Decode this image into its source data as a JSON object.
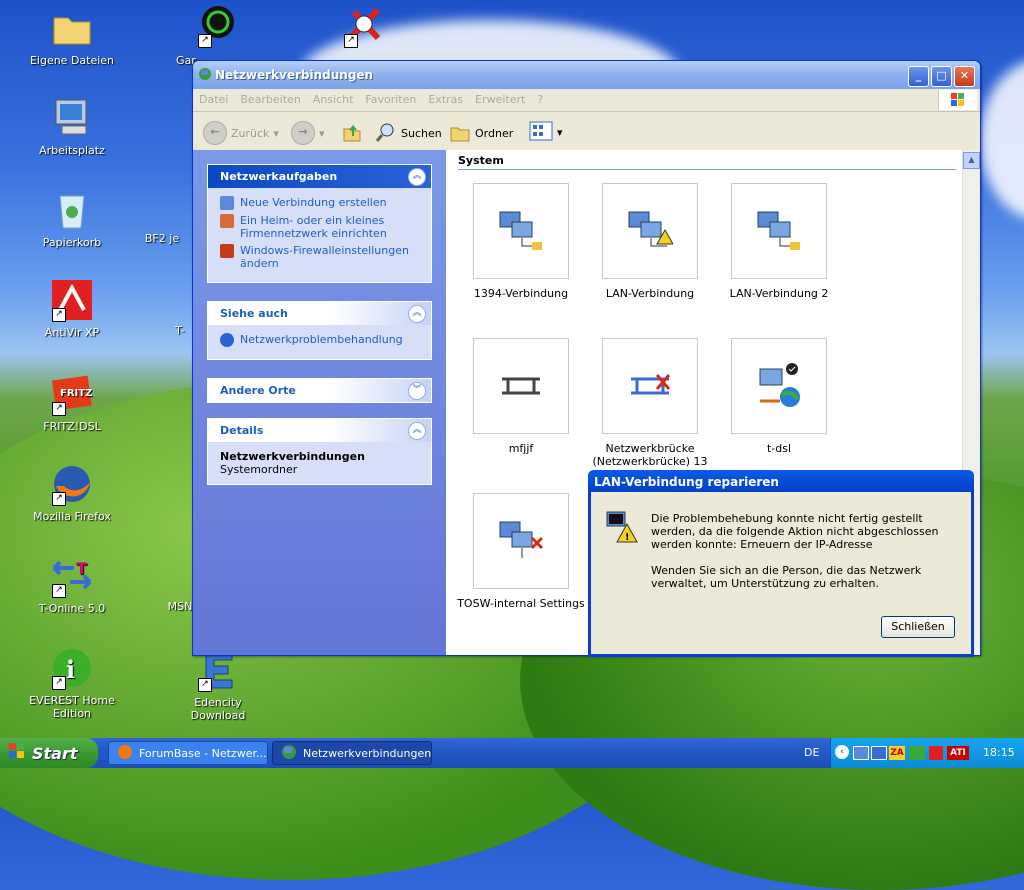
{
  "desktop": {
    "icons": [
      {
        "label": "Eigene Dateien"
      },
      {
        "label": "Arbeitsplatz"
      },
      {
        "label": "Papierkorb"
      },
      {
        "label": "AntiVir XP"
      },
      {
        "label": "FRITZ!DSL"
      },
      {
        "label": "Mozilla Firefox"
      },
      {
        "label": "T-Online 5.0"
      },
      {
        "label": "EVEREST Home Edition"
      },
      {
        "label": "Gar"
      },
      {
        "label": "BF2 je"
      },
      {
        "label": "T-"
      },
      {
        "label": "MSN"
      },
      {
        "label": "Edencity Download"
      }
    ]
  },
  "window": {
    "title": "Netzwerkverbindungen",
    "menu": [
      "Datei",
      "Bearbeiten",
      "Ansicht",
      "Favoriten",
      "Extras",
      "Erweitert",
      "?"
    ],
    "toolbar": {
      "back": "Zurück",
      "search": "Suchen",
      "folders": "Ordner"
    },
    "tasks": {
      "title": "Netzwerkaufgaben",
      "links": [
        "Neue Verbindung erstellen",
        "Ein Heim- oder ein kleines Firmennetzwerk einrichten",
        "Windows-Firewalleinstellungen ändern"
      ]
    },
    "see_also": {
      "title": "Siehe auch",
      "links": [
        "Netzwerkproblembehandlung"
      ]
    },
    "other_places": {
      "title": "Andere Orte"
    },
    "details": {
      "title": "Details",
      "name": "Netzwerkverbindungen",
      "type": "Systemordner"
    },
    "group_header": "System",
    "items": [
      {
        "label": "1394-Verbindung"
      },
      {
        "label": "LAN-Verbindung"
      },
      {
        "label": "LAN-Verbindung 2"
      },
      {
        "label": "mfjjf"
      },
      {
        "label": "Netzwerkbrücke (Netzwerkbrücke) 13"
      },
      {
        "label": "t-dsl"
      },
      {
        "label": "TOSW-internal Settings"
      }
    ]
  },
  "dialog": {
    "title": "LAN-Verbindung reparieren",
    "message1": "Die Problembehebung konnte nicht fertig gestellt werden, da die folgende Aktion nicht abgeschlossen werden konnte: Erneuern der IP-Adresse",
    "message2": "Wenden Sie sich an die Person, die das Netzwerk verwaltet, um Unterstützung zu erhalten.",
    "close_button": "Schließen"
  },
  "taskbar": {
    "start": "Start",
    "items": [
      "ForumBase - Netzwer...",
      "Netzwerkverbindungen"
    ],
    "lang": "DE",
    "clock": "18:15"
  }
}
